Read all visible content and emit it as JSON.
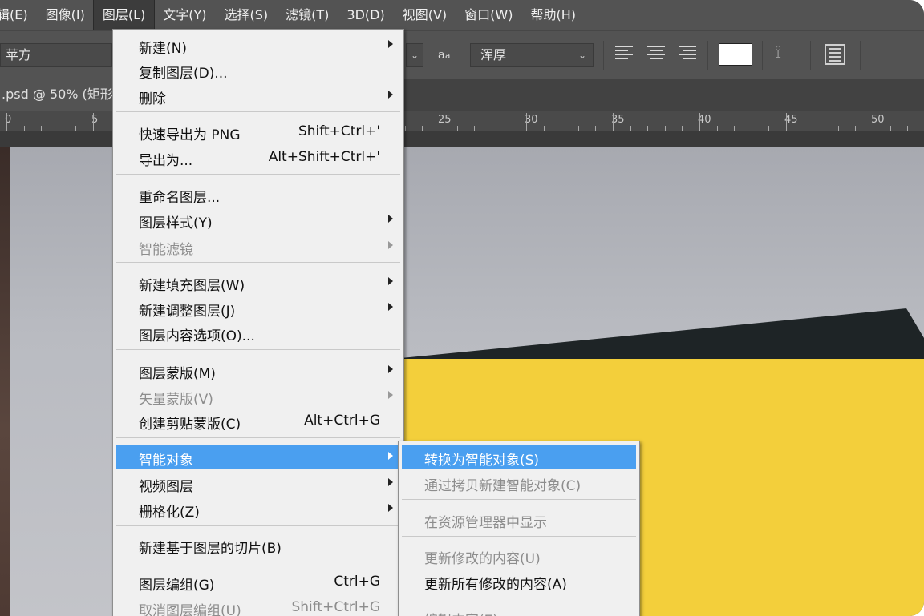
{
  "menubar": {
    "items": [
      "辑(E)",
      "图像(I)",
      "图层(L)",
      "文字(Y)",
      "选择(S)",
      "滤镜(T)",
      "3D(D)",
      "视图(V)",
      "窗口(W)",
      "帮助(H)"
    ]
  },
  "options": {
    "font_family": "苹方",
    "aa_glyph_big": "a",
    "aa_glyph_small": "a",
    "aa_value": "浑厚",
    "chevron": "⌄",
    "text_color": "#ffffff",
    "warp_glyph": "⟟"
  },
  "document": {
    "tab_title": ".psd @ 50% (矩形"
  },
  "ruler": {
    "labels": [
      "0",
      "5",
      "25",
      "30",
      "35",
      "40",
      "45",
      "50"
    ]
  },
  "layer_menu": {
    "items": [
      {
        "label": "新建(N)",
        "shortcut": "",
        "submenu": true,
        "disabled": false
      },
      {
        "label": "复制图层(D)...",
        "shortcut": "",
        "submenu": false,
        "disabled": false
      },
      {
        "label": "删除",
        "shortcut": "",
        "submenu": true,
        "disabled": false
      },
      {
        "label": "快速导出为 PNG",
        "shortcut": "Shift+Ctrl+'",
        "submenu": false,
        "disabled": false
      },
      {
        "label": "导出为...",
        "shortcut": "Alt+Shift+Ctrl+'",
        "submenu": false,
        "disabled": false
      },
      {
        "label": "重命名图层...",
        "shortcut": "",
        "submenu": false,
        "disabled": false
      },
      {
        "label": "图层样式(Y)",
        "shortcut": "",
        "submenu": true,
        "disabled": false
      },
      {
        "label": "智能滤镜",
        "shortcut": "",
        "submenu": true,
        "disabled": true
      },
      {
        "label": "新建填充图层(W)",
        "shortcut": "",
        "submenu": true,
        "disabled": false
      },
      {
        "label": "新建调整图层(J)",
        "shortcut": "",
        "submenu": true,
        "disabled": false
      },
      {
        "label": "图层内容选项(O)...",
        "shortcut": "",
        "submenu": false,
        "disabled": false
      },
      {
        "label": "图层蒙版(M)",
        "shortcut": "",
        "submenu": true,
        "disabled": false
      },
      {
        "label": "矢量蒙版(V)",
        "shortcut": "",
        "submenu": true,
        "disabled": true
      },
      {
        "label": "创建剪贴蒙版(C)",
        "shortcut": "Alt+Ctrl+G",
        "submenu": false,
        "disabled": false
      },
      {
        "label": "智能对象",
        "shortcut": "",
        "submenu": true,
        "disabled": false,
        "highlighted": true
      },
      {
        "label": "视频图层",
        "shortcut": "",
        "submenu": true,
        "disabled": false
      },
      {
        "label": "栅格化(Z)",
        "shortcut": "",
        "submenu": true,
        "disabled": false
      },
      {
        "label": "新建基于图层的切片(B)",
        "shortcut": "",
        "submenu": false,
        "disabled": false
      },
      {
        "label": "图层编组(G)",
        "shortcut": "Ctrl+G",
        "submenu": false,
        "disabled": false
      },
      {
        "label": "取消图层编组(U)",
        "shortcut": "Shift+Ctrl+G",
        "submenu": false,
        "disabled": true
      }
    ]
  },
  "smart_object_menu": {
    "items": [
      {
        "label": "转换为智能对象(S)",
        "disabled": false,
        "highlighted": true
      },
      {
        "label": "通过拷贝新建智能对象(C)",
        "disabled": true
      },
      {
        "label": "在资源管理器中显示",
        "disabled": true
      },
      {
        "label": "更新修改的内容(U)",
        "disabled": true
      },
      {
        "label": "更新所有修改的内容(A)",
        "disabled": false
      },
      {
        "label": "编辑内容(E)",
        "disabled": true
      }
    ]
  },
  "colors": {
    "ui_dark": "#535353",
    "menu_bg": "#f0f0f0",
    "highlight": "#4a9ff0",
    "yellow_shape": "#f3cf3b",
    "dark_shape": "#1e2426"
  }
}
